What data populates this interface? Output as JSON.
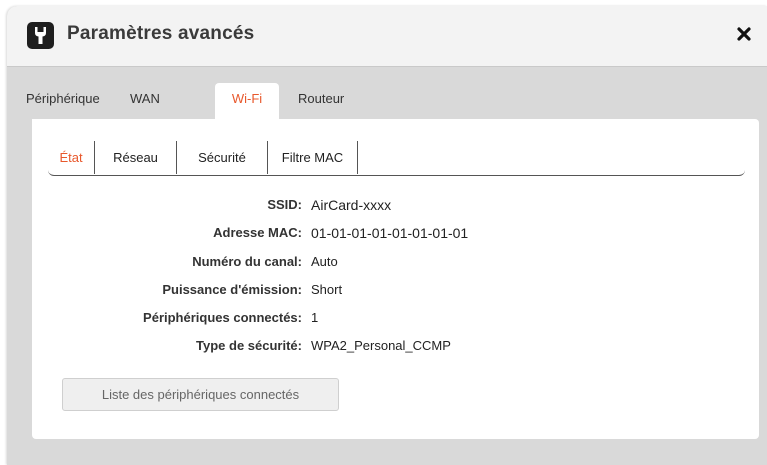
{
  "dialog": {
    "title": "Paramètres avancés",
    "icon": "wrench-icon",
    "close_icon": "close-icon",
    "close_symbol": "✖"
  },
  "main_tabs": [
    {
      "label": "Périphérique",
      "active": false
    },
    {
      "label": "WAN",
      "active": false
    },
    {
      "label": "Wi-Fi",
      "active": true
    },
    {
      "label": "Routeur",
      "active": false
    }
  ],
  "sub_tabs": [
    {
      "label": "État",
      "active": true
    },
    {
      "label": "Réseau",
      "active": false
    },
    {
      "label": "Sécurité",
      "active": false
    },
    {
      "label": "Filtre MAC",
      "active": false
    }
  ],
  "info": [
    {
      "label": "SSID:",
      "value": "AirCard-xxxx"
    },
    {
      "label": "Adresse MAC:",
      "value": "01-01-01-01-01-01-01-01"
    },
    {
      "label": "Numéro du canal:",
      "value": "Auto"
    },
    {
      "label": "Puissance d'émission:",
      "value": "Short"
    },
    {
      "label": "Périphériques connectés:",
      "value": "1"
    },
    {
      "label": "Type de sécurité:",
      "value": "WPA2_Personal_CCMP"
    }
  ],
  "buttons": {
    "connected_devices_list": "Liste des périphériques connectés"
  },
  "colors": {
    "accent": "#e8582c",
    "dialog_bg": "#d9d9d9",
    "title_bg": "#f3f3f3"
  }
}
